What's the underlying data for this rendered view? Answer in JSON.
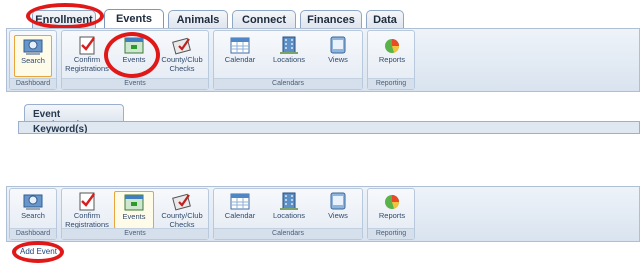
{
  "top_tabs": [
    "Enrollment",
    "Events",
    "Animals",
    "Connect",
    "Finances",
    "Data"
  ],
  "ribbon1": {
    "buttons": [
      "Search",
      "Confirm Registrations",
      "Events",
      "County/Club Checks",
      "Calendar",
      "Locations",
      "Views",
      "Reports"
    ],
    "groups": [
      "Dashboard",
      "Events",
      "Calendars",
      "Reporting"
    ]
  },
  "panel": {
    "tab_label": "Event Registrations",
    "keyword_label": "Keyword(s)"
  },
  "ribbon2": {
    "buttons": [
      "Search",
      "Confirm Registrations",
      "Events",
      "County/Club Checks",
      "Calendar",
      "Locations",
      "Views",
      "Reports"
    ],
    "groups": [
      "Dashboard",
      "Events",
      "Calendars",
      "Reporting"
    ],
    "add_event": "Add Event"
  },
  "icons": [
    "search-icon",
    "checklist-icon",
    "events-grid-icon",
    "checks-icon",
    "calendar-icon",
    "locations-building-icon",
    "views-icon",
    "reports-pie-icon"
  ],
  "colors": {
    "highlight": "#e01818",
    "selected_border": "#e7a53b",
    "ribbon_border": "#aebfd6"
  }
}
